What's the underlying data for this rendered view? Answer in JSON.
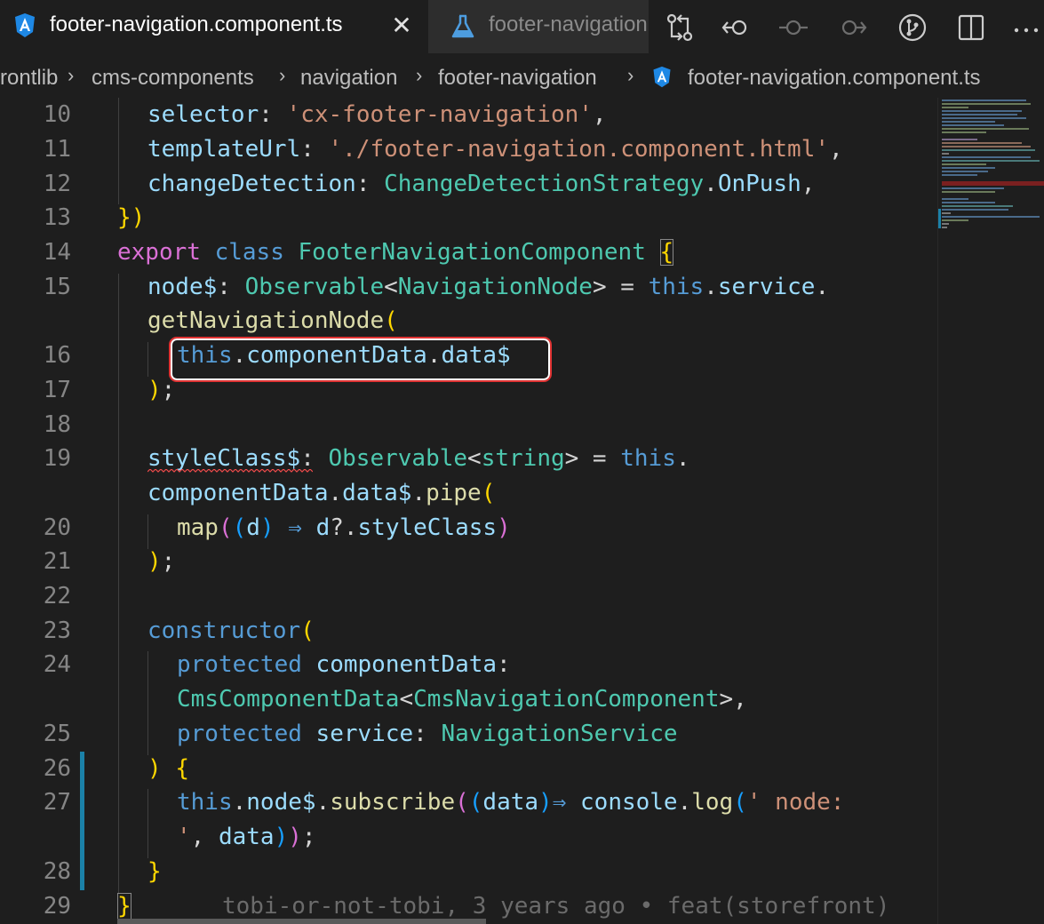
{
  "tabs": [
    {
      "label": "footer-navigation.component.ts",
      "active": true,
      "icon": "angular-icon"
    },
    {
      "label": "footer-navigation",
      "active": false,
      "icon": "flask-icon"
    }
  ],
  "actions": [
    "git-compare-icon",
    "go-back-icon",
    "git-commit-icon",
    "go-forward-icon",
    "git-graph-icon",
    "split-editor-icon",
    "more-actions-icon"
  ],
  "breadcrumb": {
    "items": [
      "rontlib",
      "cms-components",
      "navigation",
      "footer-navigation",
      "footer-navigation.component.ts"
    ]
  },
  "editor": {
    "line_numbers": [
      "10",
      "11",
      "12",
      "13",
      "14",
      "15",
      "16",
      "17",
      "18",
      "19",
      "20",
      "21",
      "22",
      "23",
      "24",
      "25",
      "26",
      "27",
      "28",
      "29"
    ],
    "blame": "tobi-or-not-tobi, 3 years ago • feat(storefront)"
  },
  "code": {
    "l10": {
      "key": "selector",
      "val": "'cx-footer-navigation'"
    },
    "l11": {
      "key": "templateUrl",
      "val": "'./footer-navigation.component.html'"
    },
    "l12": {
      "key": "changeDetection",
      "type": "ChangeDetectionStrategy",
      "member": "OnPush"
    },
    "l13": {
      "close": "})"
    },
    "l14": {
      "kw1": "export",
      "kw2": "class",
      "name": "FooterNavigationComponent"
    },
    "l15": {
      "prop": "node$",
      "type": "Observable",
      "generic": "NavigationNode",
      "this": "this",
      "member": "service",
      "fn": "getNavigationNode"
    },
    "l16": {
      "this": "this",
      "a": "componentData",
      "b": "data$"
    },
    "l19": {
      "prop": "styleClass$",
      "type": "Observable",
      "generic": "string",
      "this": "this",
      "a": "componentData",
      "b": "data$",
      "fn": "pipe"
    },
    "l20": {
      "fn": "map",
      "param": "d",
      "arrow": "⇒",
      "obj": "d",
      "member": "styleClass"
    },
    "l23": {
      "kw": "constructor"
    },
    "l24": {
      "kw": "protected",
      "prop": "componentData",
      "type": "CmsComponentData",
      "generic": "CmsNavigationComponent"
    },
    "l25": {
      "kw": "protected",
      "prop": "service",
      "type": "NavigationService"
    },
    "l27": {
      "this": "this",
      "a": "node$",
      "fn": "subscribe",
      "param": "data",
      "arrow": "⇒",
      "obj": "console",
      "fn2": "log",
      "str1": "' node:",
      "str2": "'",
      "arg": "data"
    }
  },
  "colors": {
    "keyword": "#569cd6",
    "string": "#ce9178",
    "type": "#4ec9b0",
    "property": "#9cdcfe",
    "function": "#dcdcaa",
    "git_modified": "#1b81a8",
    "highlight": "#e03333"
  }
}
